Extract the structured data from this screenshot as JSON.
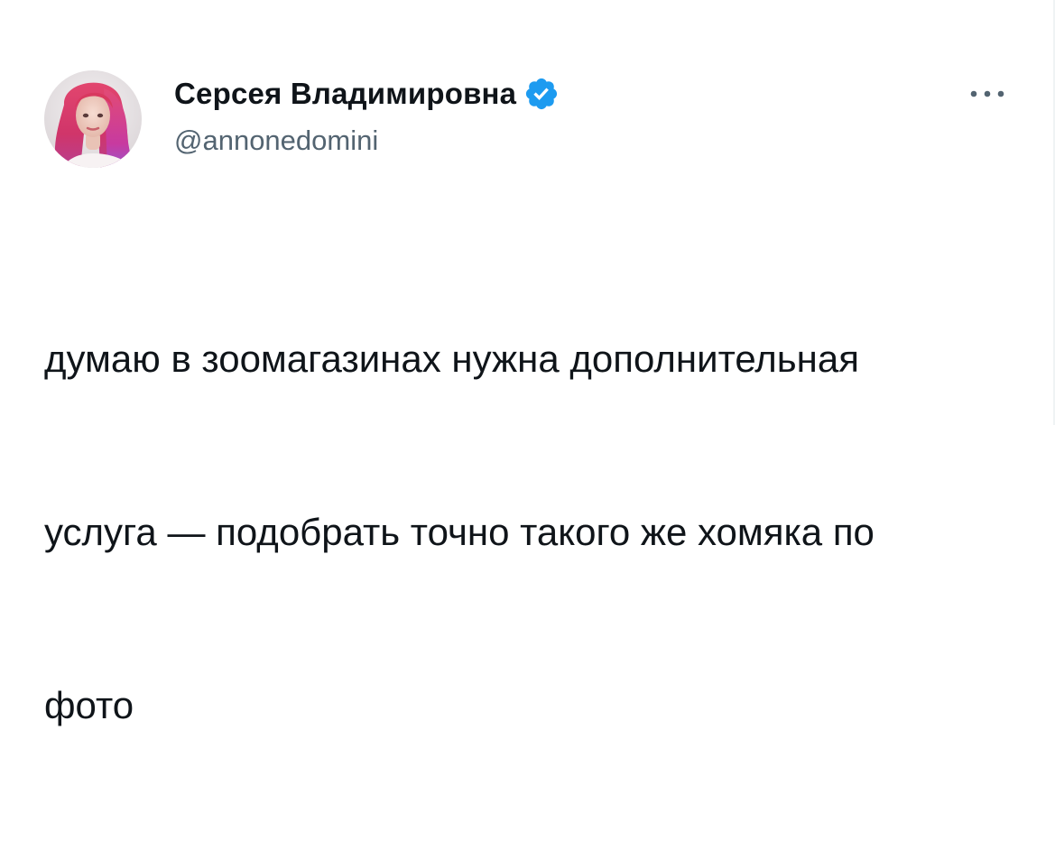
{
  "tweet": {
    "author": {
      "display_name": "Серсея Владимировна",
      "handle": "@annonedomini",
      "verified": true,
      "avatar_icon": "profile-photo-pink-hair"
    },
    "more_icon": "more-options-icon",
    "text_lines": [
      "думаю в зоомагазинах нужна дополнительная",
      "услуга — подобрать точно такого же хомяка по",
      "фото"
    ]
  },
  "colors": {
    "text": "#0f1419",
    "secondary": "#536471",
    "verified_badge": "#1d9bf0",
    "background": "#ffffff"
  }
}
